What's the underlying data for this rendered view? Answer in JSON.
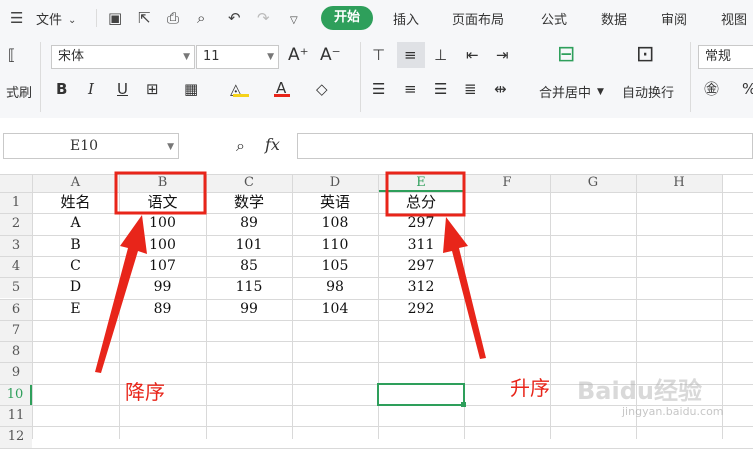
{
  "menu": {
    "file": "文件",
    "tabs": [
      "开始",
      "插入",
      "页面布局",
      "公式",
      "数据",
      "审阅",
      "视图"
    ]
  },
  "ribbon": {
    "clip_label": "式刷",
    "font_name": "宋体",
    "font_size": "11",
    "merge_label": "合并居中",
    "wrap_label": "自动换行",
    "number_format": "常规"
  },
  "formula_bar": {
    "name_box": "E10",
    "fx": "fx",
    "value": ""
  },
  "grid": {
    "columns": [
      "A",
      "B",
      "C",
      "D",
      "E",
      "F",
      "G",
      "H"
    ],
    "rows": [
      "1",
      "2",
      "3",
      "4",
      "5",
      "6",
      "7",
      "8",
      "9",
      "10",
      "11",
      "12"
    ],
    "selected_column": "E",
    "selected_row": "10",
    "selected_cell": "E10",
    "data": [
      [
        "姓名",
        "语文",
        "数学",
        "英语",
        "总分"
      ],
      [
        "A",
        "100",
        "89",
        "108",
        "297"
      ],
      [
        "B",
        "100",
        "101",
        "110",
        "311"
      ],
      [
        "C",
        "107",
        "85",
        "105",
        "297"
      ],
      [
        "D",
        "99",
        "115",
        "98",
        "312"
      ],
      [
        "E",
        "89",
        "99",
        "104",
        "292"
      ]
    ]
  },
  "annotations": {
    "descending": "降序",
    "ascending": "升序",
    "color": "#e8251a"
  },
  "watermark": {
    "brand": "Baidu经验",
    "url": "jingyan.baidu.com"
  },
  "colors": {
    "accent": "#2e9f5b"
  }
}
